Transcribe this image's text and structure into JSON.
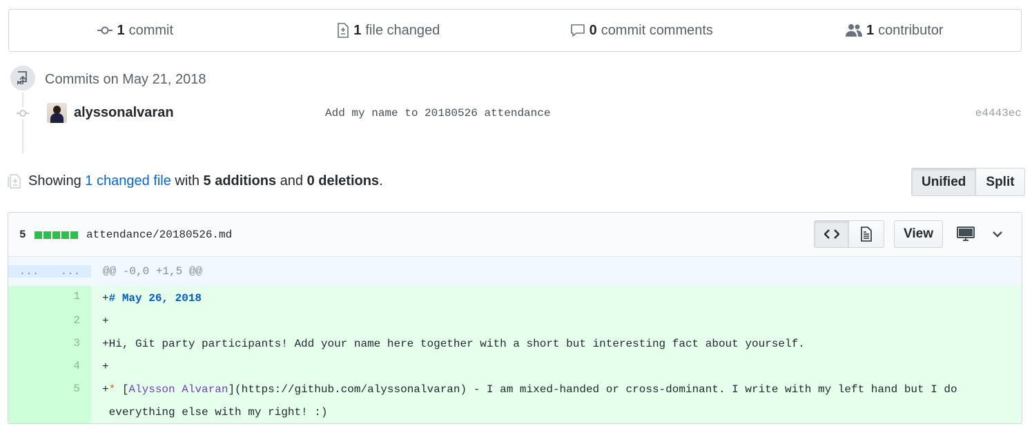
{
  "summary": {
    "commits": {
      "count": "1",
      "label": "commit"
    },
    "files": {
      "count": "1",
      "label": "file changed"
    },
    "comments": {
      "count": "0",
      "label": "commit comments"
    },
    "contributors": {
      "count": "1",
      "label": "contributor"
    }
  },
  "timeline": {
    "date": "Commits on May 21, 2018",
    "commit": {
      "author": "alyssonalvaran",
      "message": "Add my name to 20180526 attendance",
      "sha": "e4443ec"
    }
  },
  "showing": {
    "prefix": "Showing ",
    "changed_link": "1 changed file",
    "with": " with ",
    "additions": "5 additions",
    "and": " and ",
    "deletions": "0 deletions",
    "suffix": "."
  },
  "view_toggle": {
    "unified": "Unified",
    "split": "Split"
  },
  "file": {
    "diffstat": "5",
    "diffstat_blocks": 5,
    "name": "attendance/20180526.md",
    "view_label": "View",
    "hunk": {
      "old_num": "...",
      "new_num": "...",
      "header": "@@ -0,0 +1,5 @@"
    },
    "lines": [
      {
        "num": "1",
        "plus": "+",
        "parts": [
          {
            "t": "# May 26, 2018",
            "c": "head"
          }
        ]
      },
      {
        "num": "2",
        "plus": "+",
        "parts": []
      },
      {
        "num": "3",
        "plus": "+",
        "parts": [
          {
            "t": "Hi, Git party participants! Add your name here together with a short but interesting fact about yourself.",
            "c": ""
          }
        ]
      },
      {
        "num": "4",
        "plus": "+",
        "parts": []
      },
      {
        "num": "5",
        "plus": "+",
        "parts": [
          {
            "t": "*",
            "c": "bullet"
          },
          {
            "t": " [",
            "c": ""
          },
          {
            "t": "Alysson Alvaran",
            "c": "link"
          },
          {
            "t": "](https://github.com/alyssonalvaran) - I am mixed-handed or cross-dominant. I write with my left hand but I do\n everything else with my right! :)",
            "c": ""
          }
        ]
      }
    ]
  },
  "colors": {
    "addition_bg": "#e6ffed",
    "addition_num_bg": "#cdffd8",
    "diffstat_green": "#2cbe4e",
    "link": "#0366d6"
  }
}
